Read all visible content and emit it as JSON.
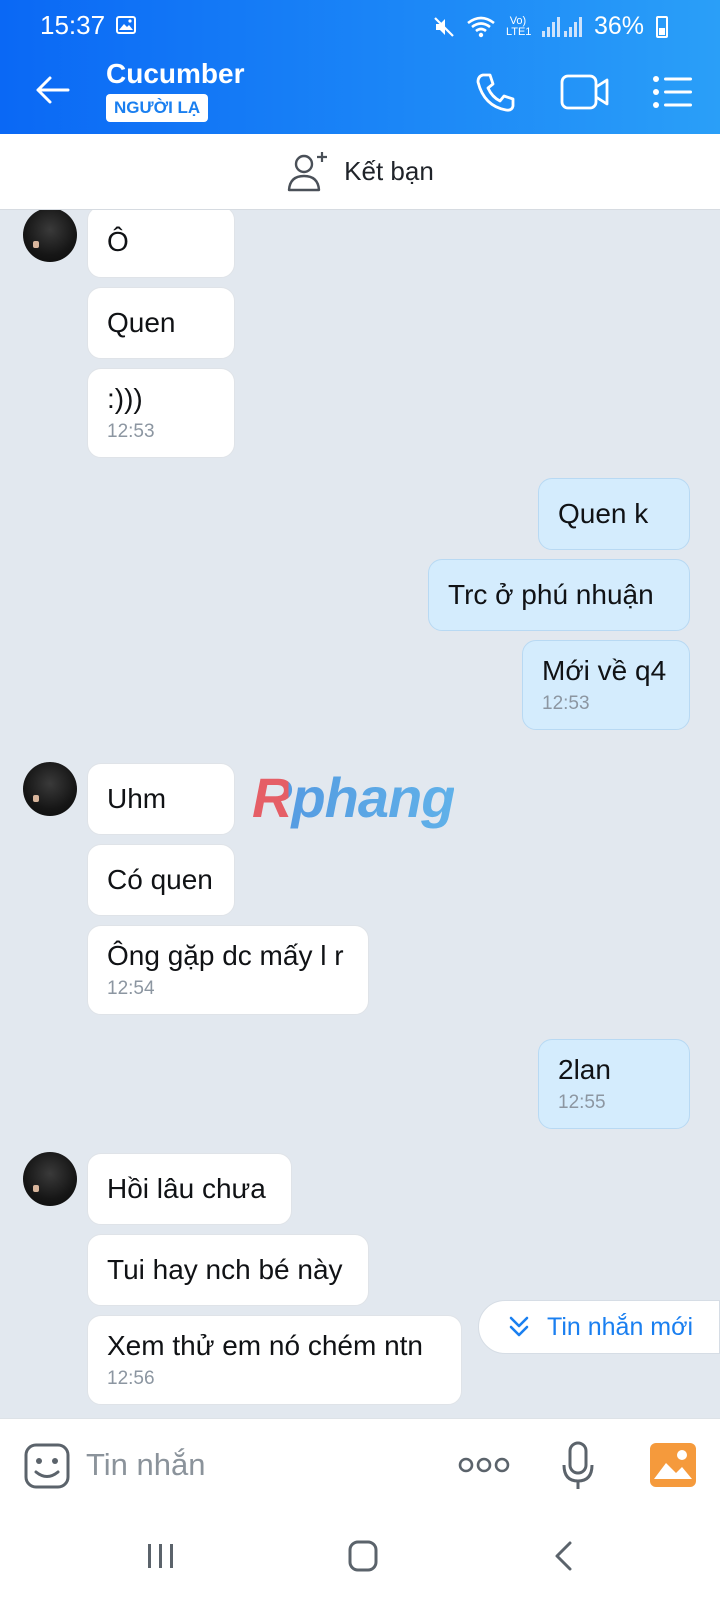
{
  "status_bar": {
    "time": "15:37",
    "network_label": "Vo) LTE1",
    "battery": "36%",
    "icons": [
      "gallery-icon",
      "mute-icon",
      "wifi-icon",
      "signal-icon",
      "battery-icon"
    ]
  },
  "header": {
    "name": "Cucumber",
    "badge": "NGƯỜI LẠ",
    "icons": [
      "back-arrow-icon",
      "phone-icon",
      "video-call-icon",
      "list-menu-icon"
    ]
  },
  "add_friend": {
    "label": "Kết bạn",
    "icon": "add-person-icon"
  },
  "colors": {
    "header_gradient": [
      "#0a68f5",
      "#2a9ff8"
    ],
    "chat_background": "#e2e8ef",
    "incoming_bubble": "#ffffff",
    "outgoing_bubble": "#d4ecfd",
    "accent": "#1a7ff0"
  },
  "messages": [
    {
      "dir": "in",
      "text": "Ô"
    },
    {
      "dir": "in",
      "text": "Quen"
    },
    {
      "dir": "in",
      "text": ":)))",
      "time": "12:53"
    },
    {
      "dir": "out",
      "text": "Quen k"
    },
    {
      "dir": "out",
      "text": "Trc ở phú nhuận"
    },
    {
      "dir": "out",
      "text": "Mới về q4",
      "time": "12:53"
    },
    {
      "dir": "in",
      "text": "Uhm"
    },
    {
      "dir": "in",
      "text": "Có quen"
    },
    {
      "dir": "in",
      "text": "Ông gặp dc mấy l r",
      "time": "12:54"
    },
    {
      "dir": "out",
      "text": "2lan",
      "time": "12:55"
    },
    {
      "dir": "in",
      "text": "Hồi lâu chưa"
    },
    {
      "dir": "in",
      "text": "Tui hay nch bé này"
    },
    {
      "dir": "in",
      "text": "Xem thử em nó chém ntn",
      "time": "12:56"
    }
  ],
  "watermark": "Rphang",
  "new_messages_button": {
    "label": "Tin nhắn mới",
    "icon": "double-chevron-down-icon"
  },
  "input": {
    "placeholder": "Tin nhắn",
    "value": "",
    "icons": [
      "sticker-icon",
      "more-icon",
      "microphone-icon",
      "image-gallery-icon"
    ]
  },
  "nav_bar": {
    "icons": [
      "recent-apps-icon",
      "home-icon",
      "back-icon"
    ]
  }
}
